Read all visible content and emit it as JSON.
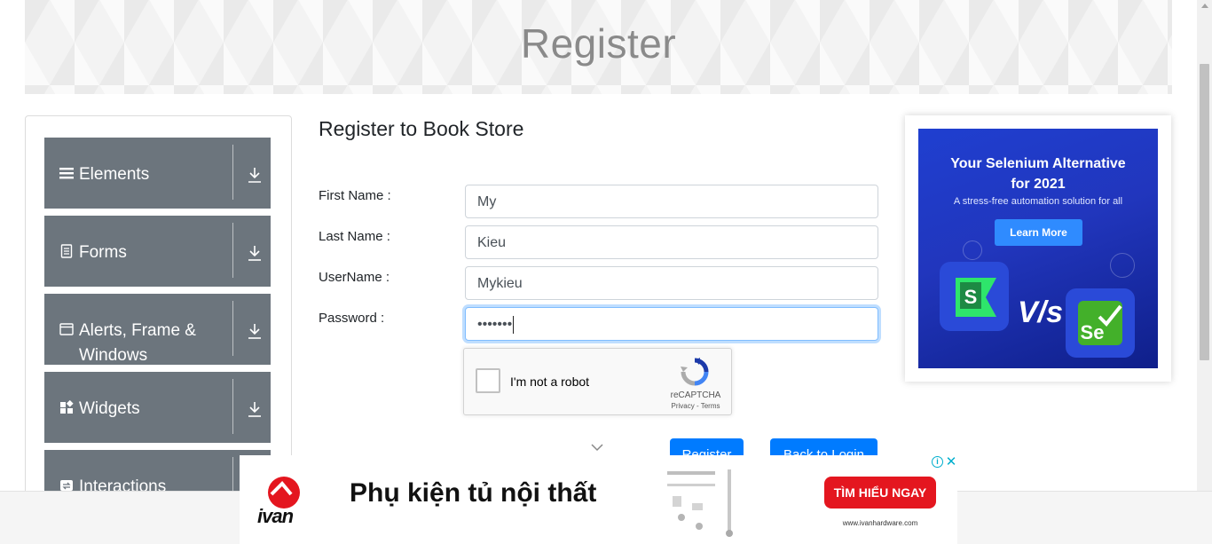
{
  "header": {
    "title": "Register"
  },
  "sidebar": {
    "groups": [
      {
        "label": "Elements",
        "icon": "menu-icon"
      },
      {
        "label": "Forms",
        "icon": "document-icon"
      },
      {
        "label": "Alerts, Frame & Windows",
        "icon": "window-icon"
      },
      {
        "label": "Widgets",
        "icon": "widgets-icon"
      },
      {
        "label": "Interactions",
        "icon": "interactions-icon"
      }
    ]
  },
  "form": {
    "title": "Register to Book Store",
    "first_name_label": "First Name :",
    "first_name_value": "My",
    "last_name_label": "Last Name :",
    "last_name_value": "Kieu",
    "username_label": "UserName :",
    "username_value": "Mykieu",
    "password_label": "Password :",
    "password_value": "•••••••",
    "register_button": "Register",
    "back_button": "Back to Login"
  },
  "recaptcha": {
    "label": "I'm not a robot",
    "brand": "reCAPTCHA",
    "links": "Privacy - Terms"
  },
  "right_ad": {
    "headline_line1": "Your Selenium Alternative",
    "headline_line2": "for 2021",
    "subtitle": "A stress-free automation solution for all",
    "button": "Learn More",
    "vs": "V/s",
    "logo_left": "S",
    "logo_right": "Se"
  },
  "bottom_ad": {
    "brand": "ivan",
    "title": "Phụ kiện tủ nội thất",
    "cta": "TÌM HIỂU NGAY",
    "url": "www.ivanhardware.com",
    "info_icon": "i",
    "close_icon": "✕"
  },
  "colors": {
    "accent": "#007bff",
    "sidebar_group": "#6c757d",
    "ad_cta": "#e4161f"
  }
}
